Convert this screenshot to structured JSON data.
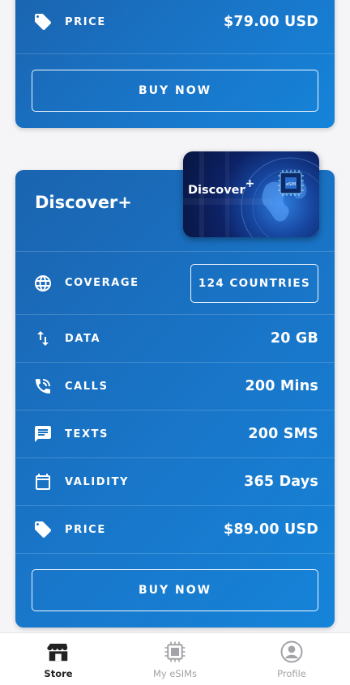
{
  "top_card": {
    "price_label": "PRICE",
    "price_value": "$79.00 USD",
    "buy_label": "BUY NOW"
  },
  "plan": {
    "title": "Discover+",
    "image_text": "Discover",
    "image_sup": "+",
    "image_chip_text": "eSIM",
    "coverage_label": "COVERAGE",
    "coverage_value": "124 COUNTRIES",
    "data_label": "DATA",
    "data_value": "20 GB",
    "calls_label": "CALLS",
    "calls_value": "200 Mins",
    "texts_label": "TEXTS",
    "texts_value": "200 SMS",
    "validity_label": "VALIDITY",
    "validity_value": "365 Days",
    "price_label": "PRICE",
    "price_value": "$89.00 USD",
    "buy_label": "BUY NOW"
  },
  "nav": {
    "store": "Store",
    "esims": "My eSIMs",
    "profile": "Profile"
  },
  "colors": {
    "card_gradient_start": "#1a64b0",
    "card_gradient_end": "#1584d9",
    "background": "#f5f5f7",
    "nav_active": "#222222",
    "nav_inactive": "#a3a3a8"
  },
  "icons": [
    "price-tag-icon",
    "globe-icon",
    "data-arrows-icon",
    "phone-icon",
    "message-icon",
    "calendar-icon",
    "store-icon",
    "sim-chip-icon",
    "profile-icon"
  ]
}
